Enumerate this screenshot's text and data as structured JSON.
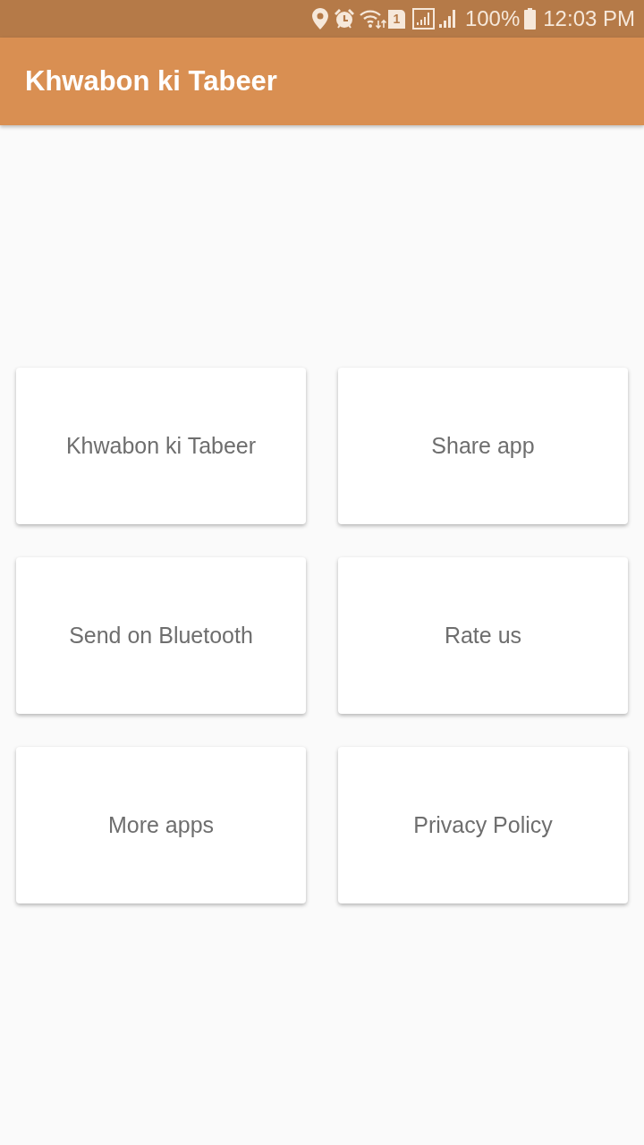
{
  "status_bar": {
    "sim_badge": "1",
    "battery": "100%",
    "time": "12:03 PM"
  },
  "app_bar": {
    "title": "Khwabon ki Tabeer"
  },
  "menu": [
    {
      "label": "Khwabon ki Tabeer"
    },
    {
      "label": "Share app"
    },
    {
      "label": "Send on Bluetooth"
    },
    {
      "label": "Rate us"
    },
    {
      "label": "More apps"
    },
    {
      "label": "Privacy Policy"
    }
  ]
}
